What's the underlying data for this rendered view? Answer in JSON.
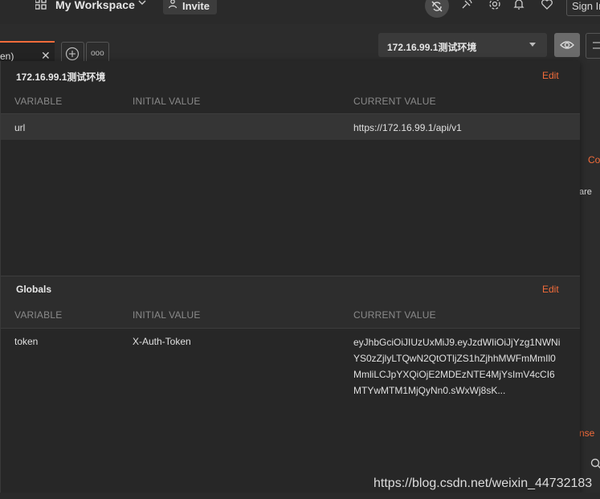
{
  "topbar": {
    "workspace_name": "My Workspace",
    "invite_label": "Invite",
    "signin_label": "Sign In"
  },
  "tabs": {
    "active_label": "en)",
    "close_glyph": "✕",
    "more_glyph": "ooo"
  },
  "environment": {
    "selected": "172.16.99.1测试环境"
  },
  "env_panel": {
    "title": "172.16.99.1测试环境",
    "edit_label": "Edit",
    "columns": [
      "VARIABLE",
      "INITIAL VALUE",
      "CURRENT VALUE"
    ],
    "rows": [
      {
        "variable": "url",
        "initial": "",
        "current": "https://172.16.99.1/api/v1"
      }
    ]
  },
  "globals_panel": {
    "title": "Globals",
    "edit_label": "Edit",
    "columns": [
      "VARIABLE",
      "INITIAL VALUE",
      "CURRENT VALUE"
    ],
    "rows": [
      {
        "variable": "token",
        "initial": "X-Auth-Token",
        "current": "eyJhbGciOiJIUzUxMiJ9.eyJzdWIiOiJjYzg1NWNiYS0zZjlyLTQwN2QtOTljZS1hZjhhMWFmMmIl0MmliLCJpYXQiOjE2MDEzNTE4MjYsImV4cCI6MTYwMTM1MjQyNn0.sWxWj8sK..."
      }
    ]
  },
  "background_fragments": {
    "co": "Co",
    "are": "are",
    "nse": "nse"
  },
  "watermark": "https://blog.csdn.net/weixin_44732183",
  "colors": {
    "accent": "#f26b3a",
    "panel_bg": "#272727",
    "app_bg": "#2c2c2c"
  }
}
